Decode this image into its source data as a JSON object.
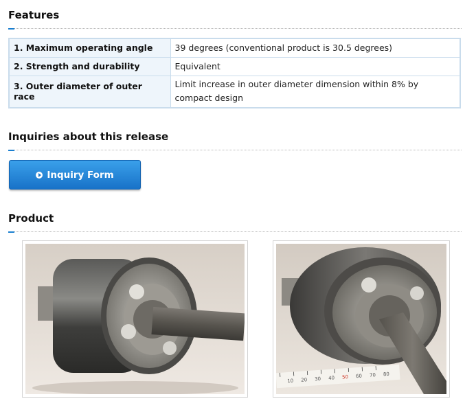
{
  "features": {
    "title": "Features",
    "rows": [
      {
        "label": "1. Maximum operating angle",
        "value": "39 degrees (conventional product is 30.5 degrees)"
      },
      {
        "label": "2. Strength and durability",
        "value": "Equivalent"
      },
      {
        "label": "3. Outer diameter of outer race",
        "value": "Limit increase in outer diameter dimension within 8% by compact design"
      }
    ]
  },
  "inquiries": {
    "title": "Inquiries about this release",
    "button_label": "Inquiry Form"
  },
  "product": {
    "title": "Product",
    "photos": [
      {
        "name": "cv-joint-side-view-photo"
      },
      {
        "name": "cv-joint-with-ruler-photo",
        "ruler_ticks": [
          "10",
          "20",
          "30",
          "40",
          "50",
          "60",
          "70",
          "80"
        ]
      }
    ]
  },
  "colors": {
    "accent": "#1a7fd0",
    "button_top": "#3aa0ea",
    "button_bottom": "#1872c8",
    "table_border": "#c9dcec",
    "label_bg": "#eef5fb"
  }
}
